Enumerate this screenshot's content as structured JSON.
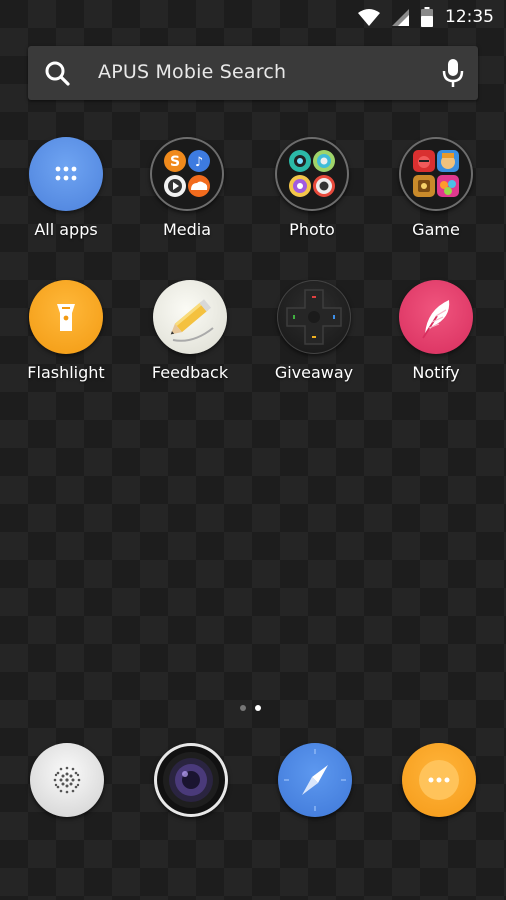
{
  "status_bar": {
    "time": "12:35",
    "icons": [
      "wifi-icon",
      "signal-icon",
      "battery-icon"
    ]
  },
  "search": {
    "placeholder": "APUS Mobie Search"
  },
  "apps": [
    {
      "label": "All apps",
      "icon": "app-drawer-icon",
      "color": "#5b93e8"
    },
    {
      "label": "Media",
      "icon": "media-folder-icon"
    },
    {
      "label": "Photo",
      "icon": "photo-folder-icon"
    },
    {
      "label": "Game",
      "icon": "game-folder-icon"
    },
    {
      "label": "Flashlight",
      "icon": "flashlight-icon",
      "color": "#f5a623"
    },
    {
      "label": "Feedback",
      "icon": "feedback-pencil-icon"
    },
    {
      "label": "Giveaway",
      "icon": "gamepad-icon"
    },
    {
      "label": "Notify",
      "icon": "feather-icon",
      "color": "#e8396a"
    }
  ],
  "page_indicator": {
    "current": 2,
    "total": 2
  },
  "dock": [
    {
      "icon": "phone-speaker-icon"
    },
    {
      "icon": "camera-icon"
    },
    {
      "icon": "compass-browser-icon",
      "color": "#4a86e8"
    },
    {
      "icon": "more-icon",
      "color": "#f7a829"
    }
  ]
}
